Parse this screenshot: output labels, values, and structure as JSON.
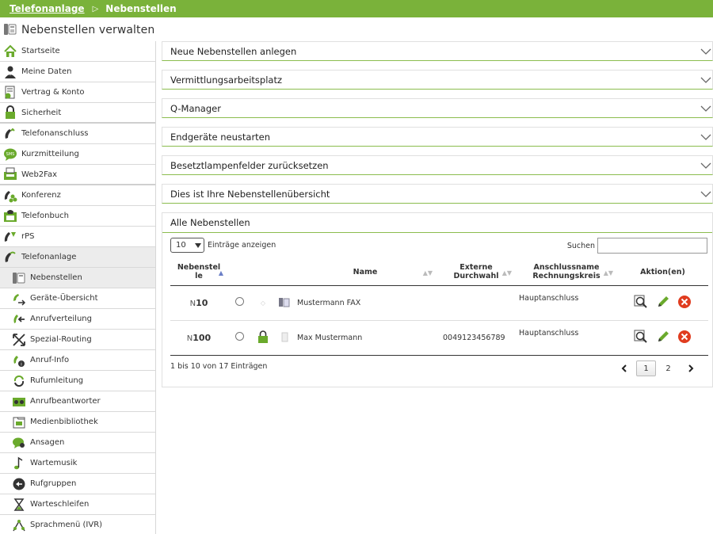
{
  "breadcrumb": {
    "root": "Telefonanlage",
    "current": "Nebenstellen"
  },
  "page": {
    "title": "Nebenstellen verwalten"
  },
  "sidebar": {
    "items": [
      {
        "label": "Startseite",
        "icon": "home-icon"
      },
      {
        "label": "Meine Daten",
        "icon": "user-icon"
      },
      {
        "label": "Vertrag & Konto",
        "icon": "contract-icon"
      },
      {
        "label": "Sicherheit",
        "icon": "lock-icon"
      },
      {
        "label": "Telefonanschluss",
        "icon": "phone-icon"
      },
      {
        "label": "Kurzmitteilung",
        "icon": "sms-icon"
      },
      {
        "label": "Web2Fax",
        "icon": "fax-icon"
      },
      {
        "label": "Konferenz",
        "icon": "conference-icon"
      },
      {
        "label": "Telefonbuch",
        "icon": "phonebook-icon"
      },
      {
        "label": "rPS",
        "icon": "rps-icon"
      },
      {
        "label": "Telefonanlage",
        "icon": "phone-system-icon"
      },
      {
        "label": "Nebenstellen",
        "icon": "extension-icon"
      },
      {
        "label": "Geräte-Übersicht",
        "icon": "devices-icon"
      },
      {
        "label": "Anrufverteilung",
        "icon": "call-distribution-icon"
      },
      {
        "label": "Spezial-Routing",
        "icon": "routing-icon"
      },
      {
        "label": "Anruf-Info",
        "icon": "call-info-icon"
      },
      {
        "label": "Rufumleitung",
        "icon": "call-forward-icon"
      },
      {
        "label": "Anrufbeantworter",
        "icon": "voicemail-icon"
      },
      {
        "label": "Medienbibliothek",
        "icon": "media-library-icon"
      },
      {
        "label": "Ansagen",
        "icon": "announcement-icon"
      },
      {
        "label": "Wartemusik",
        "icon": "music-note-icon"
      },
      {
        "label": "Rufgruppen",
        "icon": "call-group-icon"
      },
      {
        "label": "Warteschleifen",
        "icon": "hourglass-icon"
      },
      {
        "label": "Sprachmenü (IVR)",
        "icon": "ivr-icon"
      }
    ]
  },
  "accordions": [
    "Neue Nebenstellen anlegen",
    "Vermittlungsarbeitsplatz",
    "Q-Manager",
    "Endgeräte neustarten",
    "Besetztlampenfelder zurücksetzen",
    "Dies ist Ihre Nebenstellenübersicht"
  ],
  "panel": {
    "title": "Alle Nebenstellen",
    "length_value": "10",
    "length_label": "Einträge anzeigen",
    "search_label": "Suchen",
    "search_value": "",
    "columns": {
      "ext_1": "Nebenstel",
      "ext_2": "le",
      "name": "Name",
      "ddi_1": "Externe",
      "ddi_2": "Durchwahl",
      "conn_1": "Anschlussname",
      "conn_2": "Rechnungskreis",
      "actions": "Aktion(en)"
    },
    "rows": [
      {
        "prefix": "N",
        "ext": "10",
        "name": "Mustermann FAX",
        "ddi": "",
        "connection": "Hauptanschluss",
        "locked": false
      },
      {
        "prefix": "N",
        "ext": "100",
        "name": "Max Mustermann",
        "ddi": "0049123456789",
        "connection": "Hauptanschluss",
        "locked": true
      }
    ],
    "info": "1 bis 10 von 17 Einträgen",
    "pages": [
      "1",
      "2"
    ],
    "prev": "‹",
    "next": "›"
  },
  "colors": {
    "accent": "#7ab23a",
    "delete": "#e03c1f",
    "edit": "#6aaa2c"
  }
}
